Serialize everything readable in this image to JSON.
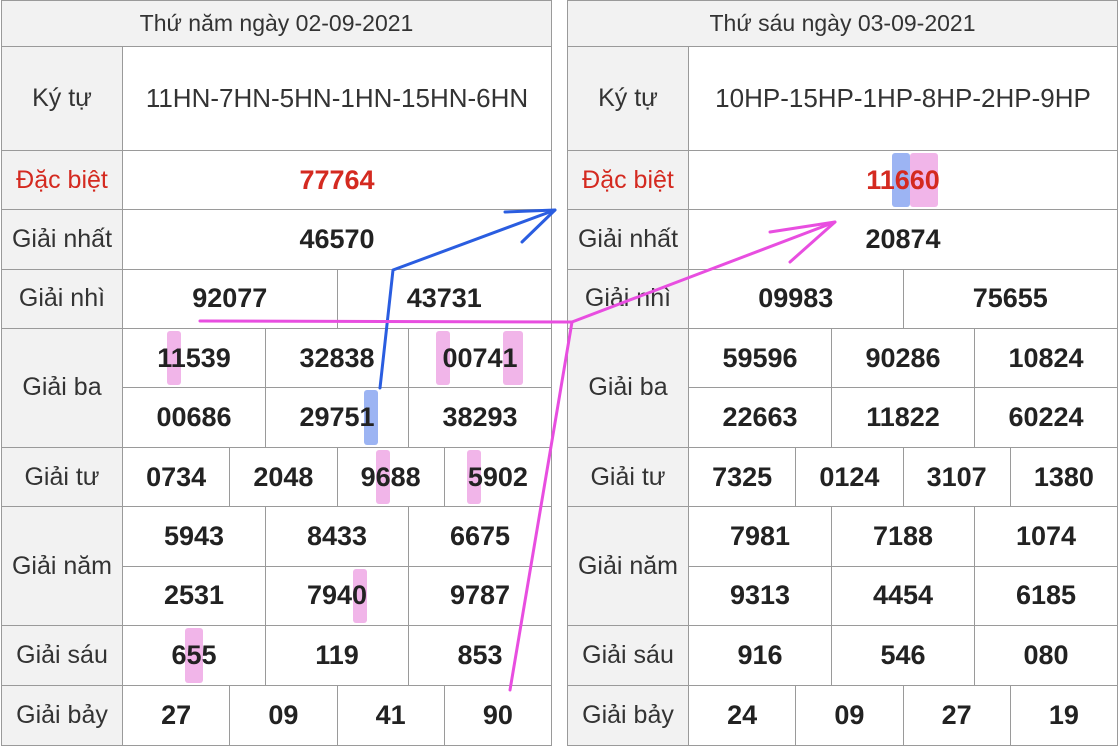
{
  "left": {
    "header": "Thứ năm ngày 02-09-2021",
    "labels": {
      "kytu": "Ký tự",
      "db": "Đặc biệt",
      "g1": "Giải nhất",
      "g2": "Giải nhì",
      "g3": "Giải ba",
      "g4": "Giải tư",
      "g5": "Giải năm",
      "g6": "Giải sáu",
      "g7": "Giải bảy"
    },
    "kytu": "11HN-7HN-5HN-1HN-15HN-6HN",
    "db": "77764",
    "g1": "46570",
    "g2": [
      "92077",
      "43731"
    ],
    "g3": [
      "11539",
      "32838",
      "00741",
      "00686",
      "29751",
      "38293"
    ],
    "g4": [
      "0734",
      "2048",
      "9688",
      "5902"
    ],
    "g5": [
      "5943",
      "8433",
      "6675",
      "2531",
      "7940",
      "9787"
    ],
    "g6": [
      "655",
      "119",
      "853"
    ],
    "g7": [
      "27",
      "09",
      "41",
      "90"
    ]
  },
  "right": {
    "header": "Thứ sáu ngày 03-09-2021",
    "labels": {
      "kytu": "Ký tự",
      "db": "Đặc biệt",
      "g1": "Giải nhất",
      "g2": "Giải nhì",
      "g3": "Giải ba",
      "g4": "Giải tư",
      "g5": "Giải năm",
      "g6": "Giải sáu",
      "g7": "Giải bảy"
    },
    "kytu": "10HP-15HP-1HP-8HP-2HP-9HP",
    "db": "11660",
    "g1": "20874",
    "g2": [
      "09983",
      "75655"
    ],
    "g3": [
      "59596",
      "90286",
      "10824",
      "22663",
      "11822",
      "60224"
    ],
    "g4": [
      "7325",
      "0124",
      "3107",
      "1380"
    ],
    "g5": [
      "7981",
      "7188",
      "1074",
      "9313",
      "4454",
      "6185"
    ],
    "g6": [
      "916",
      "546",
      "080"
    ],
    "g7": [
      "24",
      "09",
      "27",
      "19"
    ]
  },
  "colors": {
    "border": "#9a9a9a",
    "label_bg": "#f2f2f2",
    "special_red": "#d42a20",
    "highlight_pink": "#e678d7",
    "highlight_blue": "#5a82eb",
    "arrow_blue": "#2a5de0",
    "arrow_magenta": "#e84ee0"
  }
}
